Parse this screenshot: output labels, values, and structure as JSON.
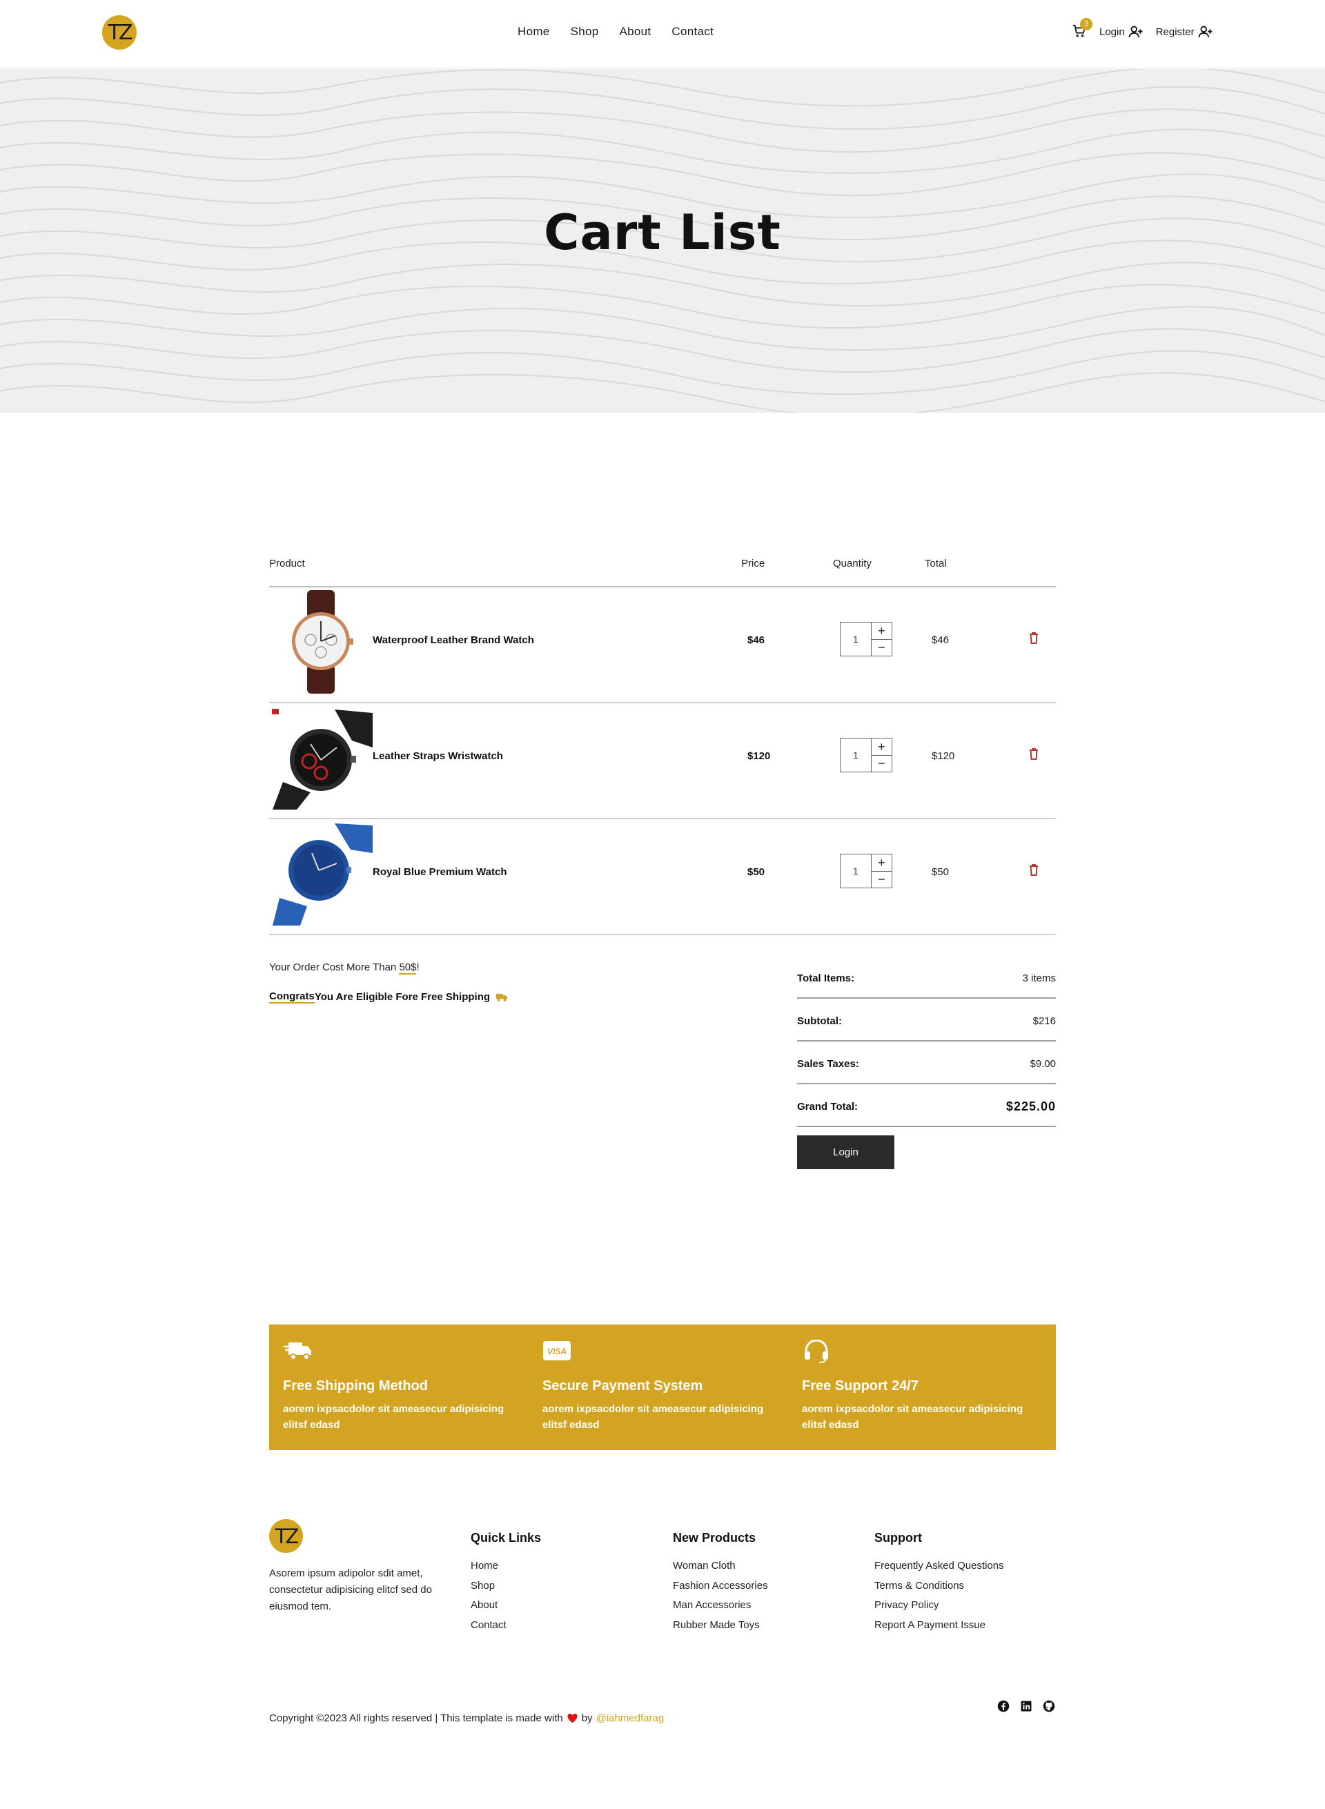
{
  "brand": {
    "logo_text": "TZ",
    "accent_color": "#d4a520"
  },
  "nav": {
    "items": [
      "Home",
      "Shop",
      "About",
      "Contact"
    ]
  },
  "header": {
    "cart_count": "3",
    "login_label": "Login",
    "register_label": "Register"
  },
  "banner": {
    "title": "Cart List"
  },
  "cart": {
    "columns": {
      "product": "Product",
      "price": "Price",
      "quantity": "Quantity",
      "total": "Total"
    },
    "items": [
      {
        "name": "Waterproof Leather Brand Watch",
        "price": "$46",
        "quantity": "1",
        "total": "$46",
        "image": "watch-leather-brown"
      },
      {
        "name": "Leather Straps Wristwatch",
        "price": "$120",
        "quantity": "1",
        "total": "$120",
        "image": "watch-black-red"
      },
      {
        "name": "Royal Blue Premium Watch",
        "price": "$50",
        "quantity": "1",
        "total": "$50",
        "image": "watch-blue-mesh"
      }
    ]
  },
  "shipping": {
    "message_prefix": "Your Order Cost More Than ",
    "amount": "50$",
    "message_suffix": "!",
    "congrats_word": "Congrats",
    "congrats_rest": " You Are Eligible Fore Free Shipping"
  },
  "summary": {
    "rows": [
      {
        "label": "Total Items:",
        "value": "3 items"
      },
      {
        "label": "Subtotal:",
        "value": "$216"
      },
      {
        "label": "Sales Taxes:",
        "value": "$9.00"
      },
      {
        "label": "Grand Total:",
        "value": "$225.00"
      }
    ],
    "button": "Login"
  },
  "features": [
    {
      "icon": "truck-icon",
      "title": "Free Shipping Method",
      "text": "aorem ixpsacdolor sit ameasecur adipisicing elitsf edasd"
    },
    {
      "icon": "visa-icon",
      "title": "Secure Payment System",
      "text": "aorem ixpsacdolor sit ameasecur adipisicing elitsf edasd"
    },
    {
      "icon": "headset-icon",
      "title": "Free Support 24/7",
      "text": "aorem ixpsacdolor sit ameasecur adipisicing elitsf edasd"
    }
  ],
  "footer": {
    "about": "Asorem ipsum adipolor sdit amet, consectetur adipisicing elitcf sed do eiusmod tem.",
    "quick_links": {
      "title": "Quick Links",
      "links": [
        "Home",
        "Shop",
        "About",
        "Contact"
      ]
    },
    "new_products": {
      "title": "New Products",
      "links": [
        "Woman Cloth",
        "Fashion Accessories",
        "Man Accessories",
        "Rubber Made Toys"
      ]
    },
    "support": {
      "title": "Support",
      "links": [
        "Frequently Asked Questions",
        "Terms & Conditions",
        "Privacy Policy",
        "Report A Payment Issue"
      ]
    },
    "copyright": "Copyright ©2023 All rights reserved | This template is made with",
    "by": "by",
    "handle": "@iahmedfarag",
    "socials": [
      "facebook-icon",
      "linkedin-icon",
      "github-icon"
    ]
  }
}
